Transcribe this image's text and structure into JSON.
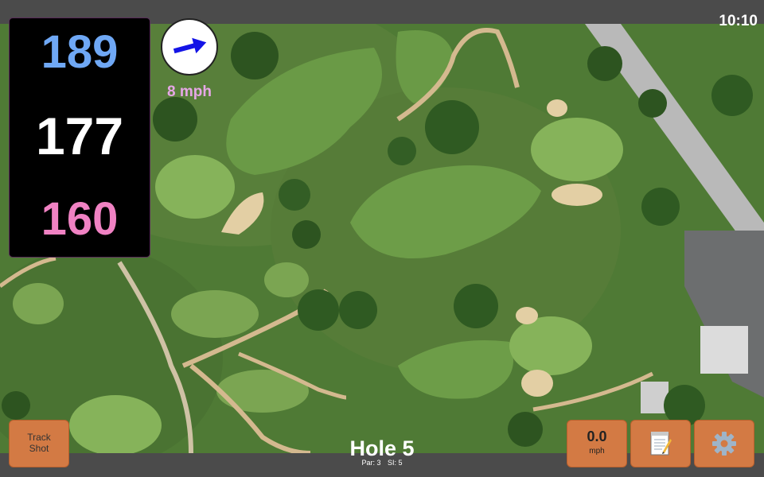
{
  "status": {
    "time": "10:10"
  },
  "distances": {
    "back": "189",
    "middle": "177",
    "front": "160"
  },
  "wind": {
    "speed": "8 mph",
    "direction_icon": "arrow-right-icon",
    "direction_deg": -15
  },
  "hole": {
    "title": "Hole 5",
    "par": "Par: 3",
    "stroke_index": "SI: 5"
  },
  "buttons": {
    "track_shot": {
      "line1": "Track",
      "line2": "Shot"
    },
    "swing_speed": {
      "value": "0.0",
      "unit": "mph"
    },
    "notes_icon": "notepad-icon",
    "settings_icon": "gear-icon"
  },
  "colors": {
    "back": "#6fa8f5",
    "middle": "#ffffff",
    "front": "#f082c3",
    "wind_label": "#e6a7e6",
    "button": "#d37a44",
    "arrow": "#1414e6"
  }
}
